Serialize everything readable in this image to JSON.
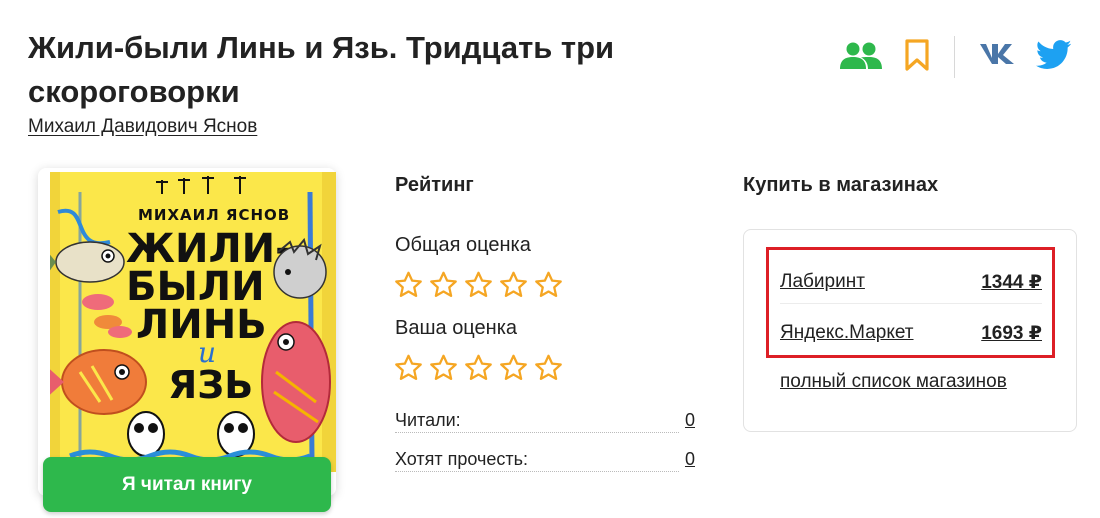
{
  "book": {
    "title": "Жили-были Линь и Язь. Тридцать три скороговорки",
    "author": "Михаил Давидович Яснов"
  },
  "header_icons": [
    {
      "name": "friends-icon",
      "color": "#2eb84c"
    },
    {
      "name": "bookmark-icon",
      "color": "#f5a623"
    },
    {
      "name": "vk-icon",
      "color": "#4a76a8"
    },
    {
      "name": "twitter-icon",
      "color": "#1da1f2"
    }
  ],
  "cover": {
    "author_text": "МИХАИЛ ЯСНОВ",
    "title_lines": [
      "ЖИЛИ-",
      "БЫЛИ",
      "ЛИНЬ",
      "и",
      "ЯЗЬ"
    ]
  },
  "read_button": {
    "label": "Я читал книгу",
    "color": "#2eb84c"
  },
  "rating": {
    "heading": "Рейтинг",
    "overall_label": "Общая оценка",
    "overall_stars": 0,
    "your_label": "Ваша оценка",
    "your_stars": 0,
    "star_color": "#f5a623",
    "stats": [
      {
        "label": "Читали:",
        "value": "0"
      },
      {
        "label": "Хотят прочесть:",
        "value": "0"
      }
    ]
  },
  "shops": {
    "heading": "Купить в магазинах",
    "items": [
      {
        "name": "Лабиринт",
        "price": "1344 ₽"
      },
      {
        "name": "Яндекс.Маркет",
        "price": "1693 ₽"
      }
    ],
    "full_list_label": "полный список магазинов",
    "highlight_color": "#dd1f26"
  }
}
